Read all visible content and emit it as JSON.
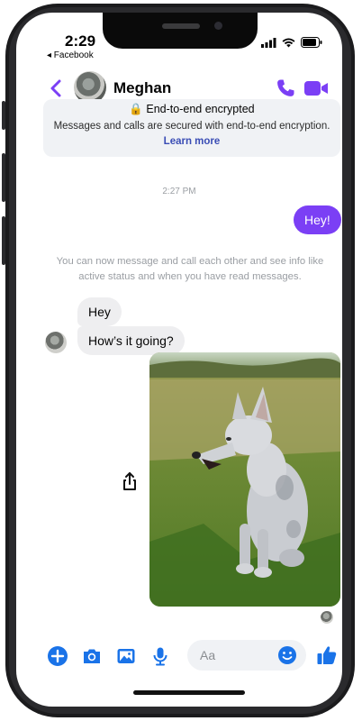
{
  "status_bar": {
    "time": "2:29",
    "back_app": "◂ Facebook"
  },
  "header": {
    "contact_name": "Meghan",
    "icons": [
      "back-chevron-icon",
      "phone-icon",
      "video-camera-icon"
    ]
  },
  "encryption_notice": {
    "title": "🔒 End-to-end encrypted",
    "body": "Messages and calls are secured with end-to-end encryption.",
    "link": "Learn more"
  },
  "conversation": {
    "timestamp": "2:27 PM",
    "outgoing_message": "Hey!",
    "info_text": "You can now message and call each other and see info like active status and when you have read messages.",
    "incoming_messages": [
      "Hey",
      "How’s it going?"
    ],
    "photo_description_icon": "share-icon"
  },
  "composer": {
    "placeholder": "Aa",
    "icons": [
      "plus-icon",
      "camera-icon",
      "gallery-icon",
      "microphone-icon",
      "emoji-icon",
      "thumbs-up-icon"
    ]
  },
  "colors": {
    "accent": "#7b3ff5",
    "composer_icons": "#1a73e8",
    "bubble_in": "#eeeef0"
  }
}
